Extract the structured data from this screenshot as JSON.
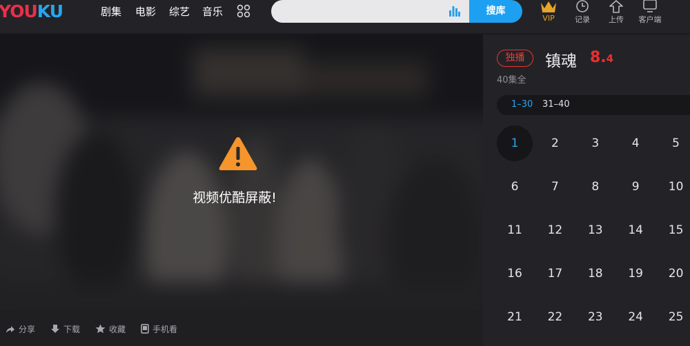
{
  "brand": {
    "logo_part1": "YOU",
    "logo_part2": "KU"
  },
  "nav": [
    {
      "label": "剧集"
    },
    {
      "label": "电影"
    },
    {
      "label": "综艺"
    },
    {
      "label": "音乐"
    }
  ],
  "search": {
    "placeholder": "",
    "button_label": "搜库"
  },
  "tools": [
    {
      "label": "VIP",
      "icon": "crown-icon"
    },
    {
      "label": "记录",
      "icon": "clock-icon"
    },
    {
      "label": "上传",
      "icon": "upload-icon"
    },
    {
      "label": "客户端",
      "icon": "monitor-icon"
    }
  ],
  "player": {
    "message": "视频优酷屏蔽!"
  },
  "bottom_toolbar": [
    {
      "label": "分享",
      "icon": "share-icon"
    },
    {
      "label": "下载",
      "icon": "download-icon"
    },
    {
      "label": "收藏",
      "icon": "star-icon"
    },
    {
      "label": "手机看",
      "icon": "phone-icon"
    }
  ],
  "show": {
    "badge": "独播",
    "title": "镇魂",
    "score_int": "8.",
    "score_dec": "4",
    "episode_count": "40集全",
    "ranges": [
      {
        "label": "1–30",
        "active": true
      },
      {
        "label": "31–40",
        "active": false
      }
    ],
    "current_episode": "1",
    "episodes": [
      "1",
      "2",
      "3",
      "4",
      "5",
      "6",
      "7",
      "8",
      "9",
      "10",
      "11",
      "12",
      "13",
      "14",
      "15",
      "16",
      "17",
      "18",
      "19",
      "20",
      "21",
      "22",
      "23",
      "24",
      "25"
    ]
  },
  "colors": {
    "accent_blue": "#1ea0f2",
    "score_red": "#ee2f2f",
    "warning_orange": "#f5952c",
    "vip_gold": "#e6a52a"
  }
}
